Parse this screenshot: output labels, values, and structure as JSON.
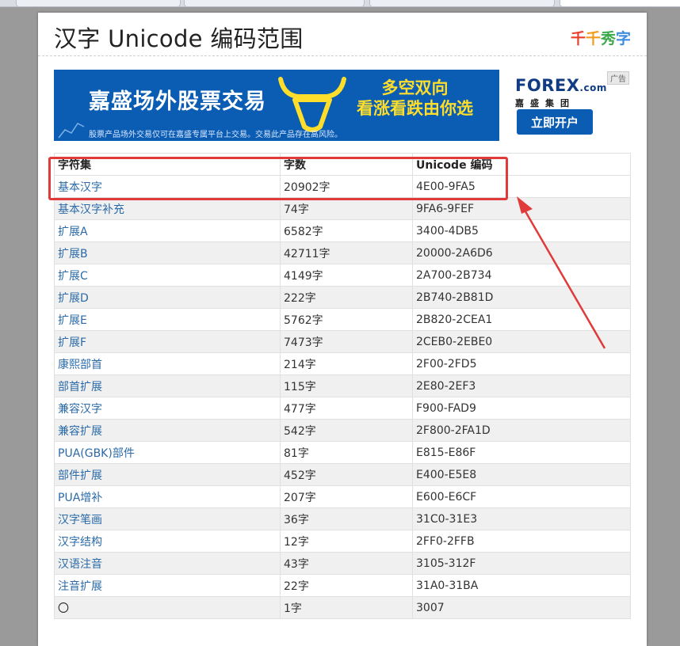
{
  "title": "汉字 Unicode 编码范围",
  "logo": {
    "chars": [
      "千",
      "千",
      "秀",
      "字"
    ],
    "colors": [
      "#e8412c",
      "#f29b1d",
      "#3aa84a",
      "#3c8de0"
    ]
  },
  "ad": {
    "headline": "嘉盛场外股票交易",
    "slogan_line1": "多空双向",
    "slogan_line2": "看涨看跌由你选",
    "disclaimer": "股票产品场外交易仅可在嘉盛专属平台上交易。交易此产品存在高风险。",
    "brand": "FOREX",
    "brand_suffix": ".com",
    "brand_sub": "嘉盛集团",
    "cta": "立即开户",
    "tag": "广告"
  },
  "table": {
    "headers": [
      "字符集",
      "字数",
      "Unicode 编码"
    ],
    "rows": [
      [
        "基本汉字",
        "20902字",
        "4E00-9FA5"
      ],
      [
        "基本汉字补充",
        "74字",
        "9FA6-9FEF"
      ],
      [
        "扩展A",
        "6582字",
        "3400-4DB5"
      ],
      [
        "扩展B",
        "42711字",
        "20000-2A6D6"
      ],
      [
        "扩展C",
        "4149字",
        "2A700-2B734"
      ],
      [
        "扩展D",
        "222字",
        "2B740-2B81D"
      ],
      [
        "扩展E",
        "5762字",
        "2B820-2CEA1"
      ],
      [
        "扩展F",
        "7473字",
        "2CEB0-2EBE0"
      ],
      [
        "康熙部首",
        "214字",
        "2F00-2FD5"
      ],
      [
        "部首扩展",
        "115字",
        "2E80-2EF3"
      ],
      [
        "兼容汉字",
        "477字",
        "F900-FAD9"
      ],
      [
        "兼容扩展",
        "542字",
        "2F800-2FA1D"
      ],
      [
        "PUA(GBK)部件",
        "81字",
        "E815-E86F"
      ],
      [
        "部件扩展",
        "452字",
        "E400-E5E8"
      ],
      [
        "PUA增补",
        "207字",
        "E600-E6CF"
      ],
      [
        "汉字笔画",
        "36字",
        "31C0-31E3"
      ],
      [
        "汉字结构",
        "12字",
        "2FF0-2FFB"
      ],
      [
        "汉语注音",
        "43字",
        "3105-312F"
      ],
      [
        "注音扩展",
        "22字",
        "31A0-31BA"
      ],
      [
        "〇",
        "1字",
        "3007"
      ]
    ]
  },
  "highlight_color": "#e03a3a"
}
